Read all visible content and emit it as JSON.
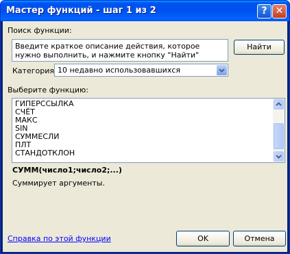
{
  "window": {
    "title": "Мастер функций - шаг 1 из 2",
    "help_glyph": "?",
    "close_glyph": "✕"
  },
  "search": {
    "label": "Поиск функции:",
    "text": "Введите краткое описание действия, которое нужно выполнить, и нажмите кнопку \"Найти\"",
    "find_button": "Найти"
  },
  "category": {
    "label": "Категория:",
    "value": "10 недавно использовавшихся"
  },
  "functions": {
    "label": "Выберите функцию:",
    "items": [
      "ГИПЕРССЫЛКА",
      "СЧЁТ",
      "МАКС",
      "SIN",
      "СУММЕСЛИ",
      "ПЛТ",
      "СТАНДОТКЛОН"
    ]
  },
  "selected": {
    "signature": "СУММ(число1;число2;...)",
    "description": "Суммирует аргументы."
  },
  "footer": {
    "help_link": "Справка по этой функции",
    "ok": "OK",
    "cancel": "Отмена"
  },
  "colors": {
    "titlebar": "#0053ee",
    "client_bg": "#ece9d8",
    "close_button": "#c13e1f",
    "field_border": "#7f9db9"
  }
}
